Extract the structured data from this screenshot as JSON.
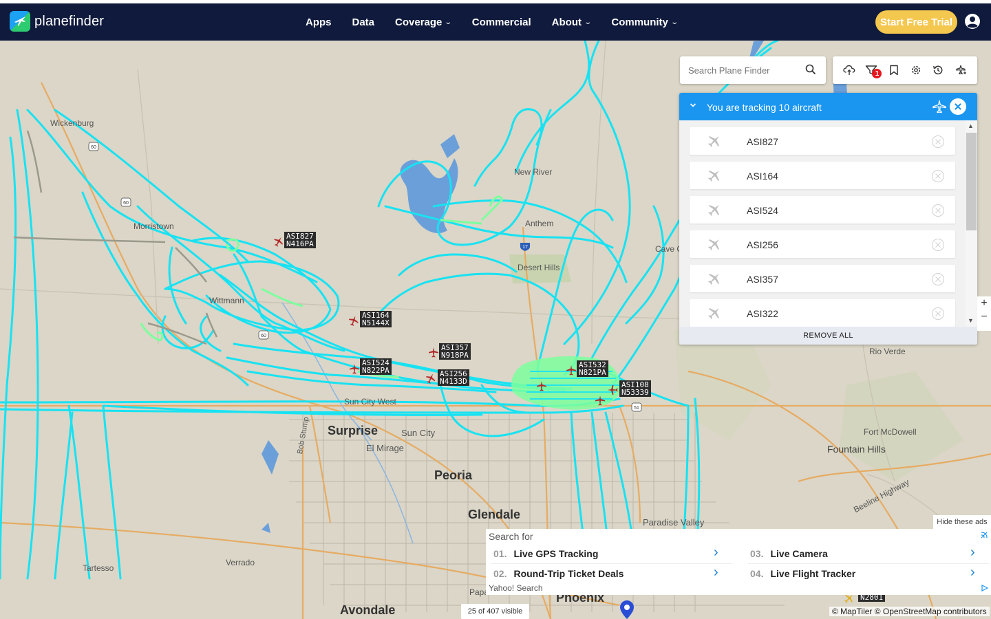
{
  "header": {
    "brand": "planefinder",
    "nav": [
      {
        "label": "Apps",
        "dropdown": false
      },
      {
        "label": "Data",
        "dropdown": false
      },
      {
        "label": "Coverage",
        "dropdown": true
      },
      {
        "label": "Commercial",
        "dropdown": false
      },
      {
        "label": "About",
        "dropdown": true
      },
      {
        "label": "Community",
        "dropdown": true
      }
    ],
    "cta_label": "Start Free Trial",
    "icons": {
      "user": "user-icon"
    }
  },
  "search": {
    "placeholder": "Search Plane Finder",
    "icon": "search-icon"
  },
  "toolbar": {
    "buttons": [
      "cloud-icon",
      "filter-icon",
      "bookmark-icon",
      "settings-icon",
      "history-icon",
      "layers-icon"
    ],
    "filter_badge": "1"
  },
  "tracking": {
    "title": "You are tracking 10 aircraft",
    "aircraft": [
      "ASI827",
      "ASI164",
      "ASI524",
      "ASI256",
      "ASI357",
      "ASI322"
    ],
    "remove_all": "REMOVE ALL"
  },
  "map": {
    "places": {
      "wickenburg": "Wickenburg",
      "morristown": "Morristown",
      "wittmann": "Wittmann",
      "new_river": "New River",
      "anthem": "Anthem",
      "desert_hills": "Desert Hills",
      "cave_creek": "Cave C",
      "rio_verde": "Rio Verde",
      "fort_mcdowell": "Fort McDowell",
      "fountain_hills": "Fountain Hills",
      "beeline": "Beeline Highway",
      "surprise": "Surprise",
      "sun_city": "Sun City",
      "sun_city_west": "Sun City West",
      "el_mirage": "El Mirage",
      "peoria": "Peoria",
      "glendale": "Glendale",
      "paradise_valley": "Paradise Valley",
      "phoenix": "Phoenix",
      "avondale": "Avondale",
      "tartesso": "Tartesso",
      "verrado": "Verrado",
      "bob_stump": "Bob Stump",
      "papago": "Papa"
    },
    "aircraft_labels": [
      {
        "callsign": "ASI827",
        "reg": "N416PA"
      },
      {
        "callsign": "ASI164",
        "reg": "N5144X"
      },
      {
        "callsign": "ASI357",
        "reg": "N918PA"
      },
      {
        "callsign": "ASI524",
        "reg": "N822PA"
      },
      {
        "callsign": "ASI256",
        "reg": "N4133D"
      },
      {
        "callsign": "ASI532",
        "reg": "N821PA"
      },
      {
        "callsign": "ASI108",
        "reg": "N53339"
      },
      {
        "callsign": "",
        "reg": "N2801"
      }
    ],
    "route_shields": [
      "60",
      "60",
      "60",
      "17",
      "51"
    ],
    "zoom_in": "+",
    "zoom_out": "−",
    "visible_count": "25 of 407 visible",
    "attribution": "© MapTiler © OpenStreetMap contributors"
  },
  "ad": {
    "hide_label": "Hide these ads",
    "title": "Search for",
    "items": [
      {
        "num": "01.",
        "label": "Live GPS Tracking"
      },
      {
        "num": "02.",
        "label": "Round-Trip Ticket Deals"
      },
      {
        "num": "03.",
        "label": "Live Camera"
      },
      {
        "num": "04.",
        "label": "Live Flight Tracker"
      }
    ],
    "footer": "Yahoo! Search"
  },
  "colors": {
    "header_bg": "#0f1a3c",
    "cta": "#f4c74e",
    "panel_head": "#1a96f0",
    "track": "#16e0f0",
    "track_low": "#7dffa0",
    "aircraft": "#b22a2a"
  }
}
